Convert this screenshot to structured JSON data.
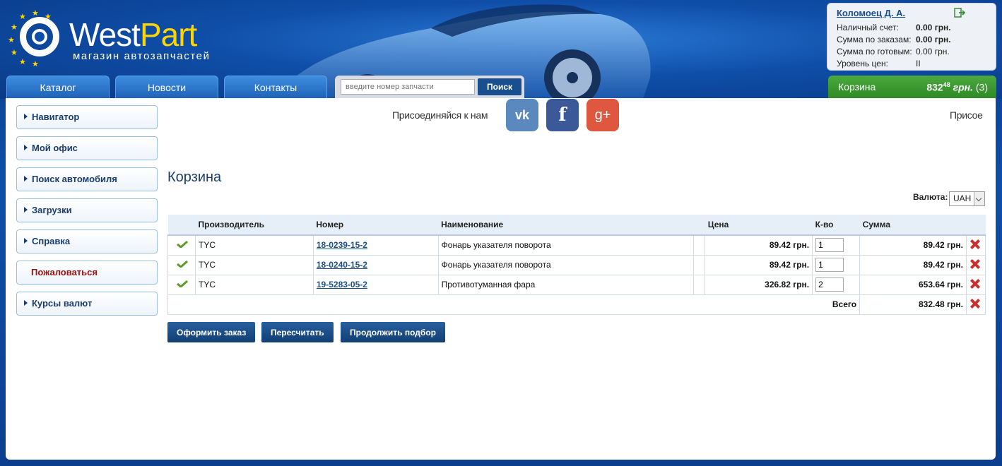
{
  "brand": {
    "name_west": "West",
    "name_part": "Part",
    "tagline": "магазин автозапчастей"
  },
  "nav": {
    "tabs": [
      {
        "label": "Каталог"
      },
      {
        "label": "Новости"
      },
      {
        "label": "Контакты"
      }
    ]
  },
  "search": {
    "placeholder": "введите номер запчасти",
    "button_label": "Поиск"
  },
  "user": {
    "name": "Коломоец Д. А.",
    "rows": [
      {
        "label": "Наличный счет:",
        "value": "0.00 грн."
      },
      {
        "label": "Сумма по заказам:",
        "value": "0.00 грн."
      },
      {
        "label": "Сумма по готовым:",
        "value": "0.00 грн."
      },
      {
        "label": "Уровень цен:",
        "value": "II"
      }
    ]
  },
  "cart_tab": {
    "label": "Корзина",
    "total_int": "832",
    "total_dec": "48",
    "currency": "грн.",
    "count": "(3)"
  },
  "sidebar": {
    "items": [
      {
        "label": "Навигатор"
      },
      {
        "label": "Мой офис"
      },
      {
        "label": "Поиск автомобиля"
      },
      {
        "label": "Загрузки"
      },
      {
        "label": "Справка"
      },
      {
        "label": "Пожаловаться"
      },
      {
        "label": "Курсы валют"
      }
    ]
  },
  "social": {
    "join_label": "Присоединяйся к нам",
    "join_label_cut": "Присое",
    "vk": "vk",
    "fb": "f",
    "gp": "g+"
  },
  "page": {
    "title": "Корзина"
  },
  "currency": {
    "label": "Валюта:",
    "selected": "UAH"
  },
  "table": {
    "headers": {
      "maker": "Производитель",
      "number": "Номер",
      "name": "Наименование",
      "price": "Цена",
      "qty": "К-во",
      "sum": "Сумма"
    },
    "rows": [
      {
        "maker": "TYC",
        "number": "18-0239-15-2",
        "name": "Фонарь указателя поворота",
        "price": "89.42 грн.",
        "qty": "1",
        "sum": "89.42 грн."
      },
      {
        "maker": "TYC",
        "number": "18-0240-15-2",
        "name": "Фонарь указателя поворота",
        "price": "89.42 грн.",
        "qty": "1",
        "sum": "89.42 грн."
      },
      {
        "maker": "TYC",
        "number": "19-5283-05-2",
        "name": "Противотуманная фара",
        "price": "326.82 грн.",
        "qty": "2",
        "sum": "653.64 грн."
      }
    ],
    "total_label": "Всего",
    "total_value": "832.48 грн."
  },
  "buttons": {
    "checkout": "Оформить заказ",
    "recalc": "Пересчитать",
    "continue": "Продолжить подбор"
  },
  "colors": {
    "accent": "#1a4f8f",
    "cart_green": "#2d8a25",
    "delete_red": "#c9302c",
    "star_yellow": "#ffd500"
  }
}
